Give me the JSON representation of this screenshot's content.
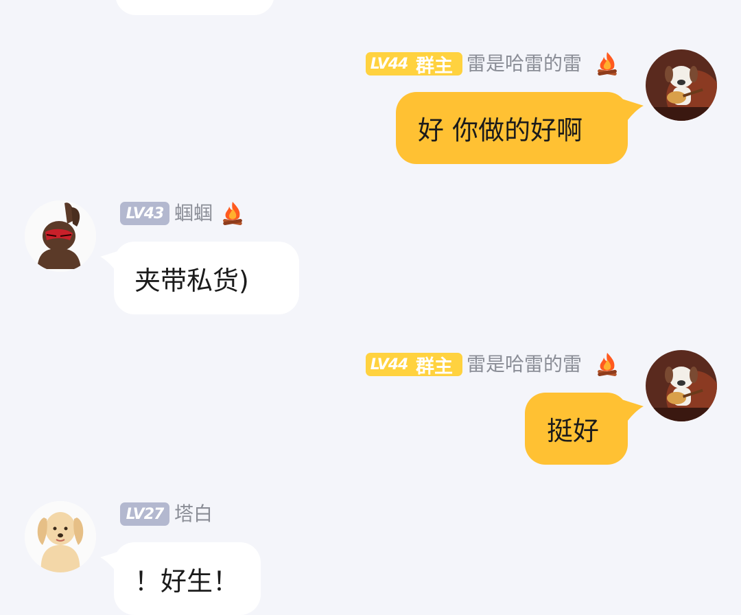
{
  "messages": [
    {
      "side": "right",
      "level": "LV44",
      "role": "群主",
      "nickname": "雷是哈雷的雷",
      "text": "好 你做的好啊",
      "flame": true
    },
    {
      "side": "left",
      "level": "LV43",
      "nickname": "蝈蝈",
      "text": "夹带私货)",
      "flame": true
    },
    {
      "side": "right",
      "level": "LV44",
      "role": "群主",
      "nickname": "雷是哈雷的雷",
      "text": "挺好",
      "flame": true
    },
    {
      "side": "left",
      "level": "LV27",
      "nickname": "塔白",
      "text": "！好生！",
      "flame": false
    }
  ],
  "icons": {
    "flame": "campfire-icon",
    "avatars": [
      "dog-guitar-avatar",
      "brown-rabbit-avatar",
      "golden-dog-avatar"
    ]
  },
  "colors": {
    "background": "#f4f5fa",
    "own_bubble": "#ffc133",
    "other_bubble": "#ffffff",
    "owner_badge": "#ffd23f",
    "level_badge": "#b3b8cf",
    "nickname": "#8a8d96"
  }
}
